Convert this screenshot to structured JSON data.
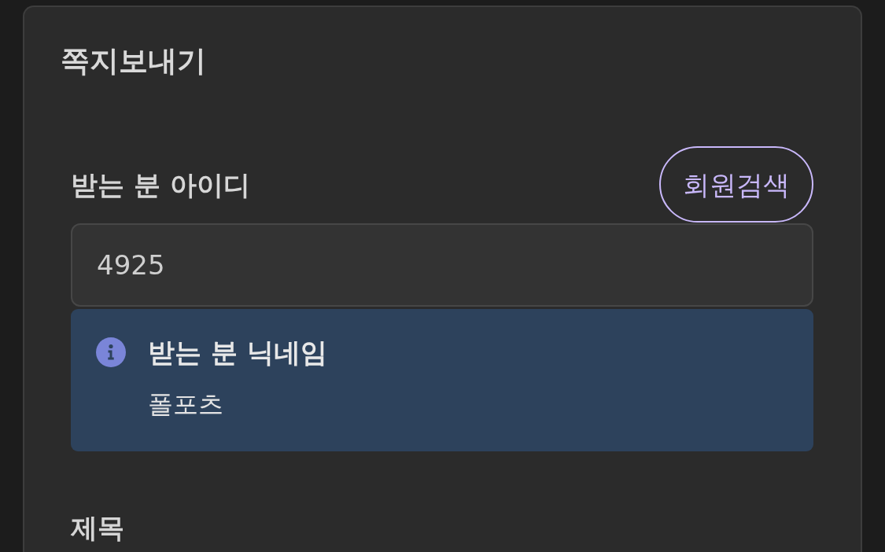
{
  "dialog": {
    "title": "쪽지보내기"
  },
  "recipient": {
    "label": "받는 분 아이디",
    "search_button": "회원검색",
    "value": "4925"
  },
  "nickname_notice": {
    "heading": "받는 분 닉네임",
    "text": "폴포츠"
  },
  "subject": {
    "label": "제목"
  }
}
